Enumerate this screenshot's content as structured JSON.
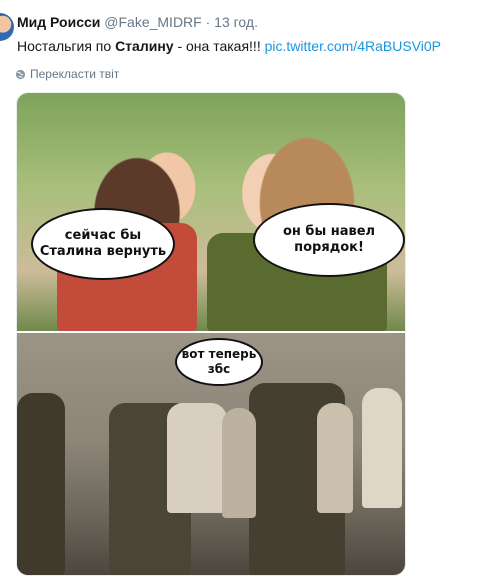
{
  "tweet": {
    "author_name": "Мид Роисси",
    "handle": "@Fake_MIDRF",
    "separator": "·",
    "time": "13 год.",
    "text_before": "Ностальгия по ",
    "text_bold": "Сталину",
    "text_after": " - она такая!!! ",
    "link": "pic.twitter.com/4RaBUSVi0P",
    "translate_label": "Перекласти твіт",
    "translate_icon": "globe-icon"
  },
  "image": {
    "bubbles": {
      "top_left": "сейчас бы Сталина вернуть",
      "top_right": "он бы навел порядок!",
      "bottom": "вот теперь збс"
    }
  }
}
